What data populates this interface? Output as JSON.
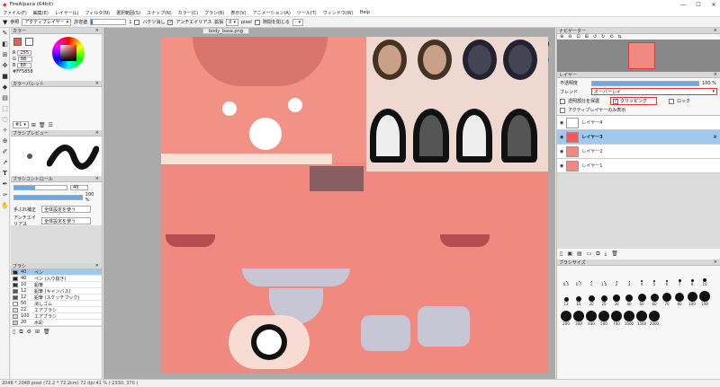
{
  "app": {
    "title": "FireAlpaca (64bit)"
  },
  "menu": [
    "ファイル(F)",
    "編集(E)",
    "レイヤー(L)",
    "フィルタ(N)",
    "選択範囲(S)",
    "スナップ(N)",
    "カラー(C)",
    "ブラシ(B)",
    "表示(V)",
    "アニメーション(A)",
    "ツール(T)",
    "ウィンドウ(W)",
    "Help"
  ],
  "toolopts": {
    "ref_label": "参照",
    "ref_value": "アクティブレイヤー",
    "tolerance_label": "許容値",
    "tolerance_value": "1",
    "bucket_label": "バケツ消し",
    "antialias_label": "アンチエイリアス",
    "expand_label": "拡張",
    "expand_value": "0",
    "expand_unit": "pixel",
    "gap_label": "隙間を閉じる",
    "gap_value": "-"
  },
  "color_panel": {
    "title": "カラー",
    "r_label": "R",
    "r_value": "255",
    "g_label": "G",
    "g_value": "88",
    "b_label": "B",
    "b_value": "88",
    "hex": "#FF5858"
  },
  "palette": {
    "title": "カラーパレット",
    "index": "#1"
  },
  "brush_preview": {
    "title": "ブラシプレビュー"
  },
  "brush_control": {
    "title": "ブラシコントロール",
    "size": "40",
    "opacity": "100 %",
    "hand_label": "手ぶれ補正",
    "hand_value": "全体設定を使う",
    "aa_label": "アンチエイリアス",
    "aa_value": "全体設定を使う"
  },
  "brushes": {
    "title": "ブラシ",
    "items": [
      {
        "size": "40",
        "name": "ペン",
        "active": true
      },
      {
        "size": "40",
        "name": "ペン (入り抜き)"
      },
      {
        "size": "10",
        "name": "鉛筆"
      },
      {
        "size": "12",
        "name": "鉛筆 (キャンバス)"
      },
      {
        "size": "12",
        "name": "鉛筆 (スケッチブック)"
      },
      {
        "size": "50",
        "name": "消しゴム"
      },
      {
        "size": "22",
        "name": "エアブラシ"
      },
      {
        "size": "100",
        "name": "エアブラシ"
      },
      {
        "size": "20",
        "name": "水彩"
      }
    ]
  },
  "canvas": {
    "tab": "body_base.png"
  },
  "navigator": {
    "title": "ナビゲーター"
  },
  "layer_panel": {
    "title": "レイヤー",
    "opacity_label": "不透明度",
    "opacity_value": "100 %",
    "blend_label": "ブレンド",
    "blend_value": "オーバーレイ",
    "protect_label": "透明部分を保護",
    "clipping_label": "クリッピング",
    "lock_label": "ロック",
    "show_active_label": "アクティブレイヤーのみ表示",
    "layers": [
      {
        "name": "レイヤー4"
      },
      {
        "name": "レイヤー3",
        "active": true
      },
      {
        "name": "レイヤー2"
      },
      {
        "name": "レイヤー1"
      }
    ]
  },
  "brush_size": {
    "title": "ブラシサイズ",
    "row1": [
      "0.5",
      "0.7",
      "1",
      "1.5",
      "2",
      "3",
      "4",
      "5",
      "6",
      "7",
      "8",
      "10"
    ],
    "row2": [
      "13",
      "15",
      "20",
      "25",
      "30",
      "40",
      "50",
      "60",
      "70",
      "80",
      "100",
      "150"
    ],
    "row3": [
      "200",
      "300",
      "400",
      "500",
      "700",
      "1000",
      "1500",
      "2000"
    ]
  },
  "status": {
    "text": "2048 * 2048 pixel  (72.2 * 72.2cm)  72 dpi  41 %  ( 2330, 370 )"
  },
  "colors": {
    "accent": "#ff5858",
    "canvas_skin": "#f08a80",
    "layer_active": "#9fc9ee"
  }
}
